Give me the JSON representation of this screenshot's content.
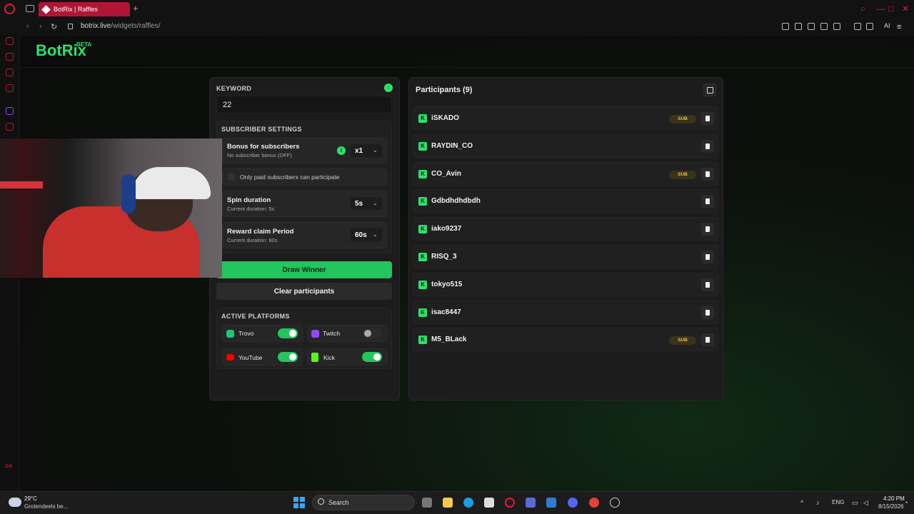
{
  "browser": {
    "tab_title": "BotRix | Raffles",
    "url_host": "botrix.live",
    "url_path": "/widgets/raffles/",
    "ai_label": "AI"
  },
  "app": {
    "logo": "BotRix",
    "beta": "BETA"
  },
  "raffle": {
    "keyword_label": "KEYWORD",
    "keyword_value": "22",
    "info_icon": "i",
    "subscriber_settings_label": "SUBSCRIBER SETTINGS",
    "bonus_title": "Bonus for subscribers",
    "bonus_sub": "No subscriber bonus (OFF)",
    "bonus_value": "x1",
    "paid_only_label": "Only paid subscribers can participate",
    "spin_title": "Spin duration",
    "spin_sub": "Current duration: 5s",
    "spin_value": "5s",
    "reward_title": "Reward claim Period",
    "reward_sub": "Current duration: 60s",
    "reward_value": "60s",
    "draw_label": "Draw Winner",
    "clear_label": "Clear participants",
    "platforms_label": "ACTIVE PLATFORMS",
    "platforms": [
      {
        "name": "Trovo",
        "enabled": true,
        "color": "#1ec47a"
      },
      {
        "name": "Twitch",
        "enabled": false,
        "color": "#9146ff"
      },
      {
        "name": "YouTube",
        "enabled": true,
        "color": "#ff0000"
      },
      {
        "name": "Kick",
        "enabled": true,
        "color": "#53fc18"
      }
    ]
  },
  "participants": {
    "title": "Participants (9)",
    "sub_badge": "SUB",
    "kick_glyph": "K",
    "list": [
      {
        "name": "iSKADO",
        "sub": true
      },
      {
        "name": "RAYDIN_CO",
        "sub": false
      },
      {
        "name": "CO_Avin",
        "sub": true
      },
      {
        "name": "Gdbdhdhdbdh",
        "sub": false
      },
      {
        "name": "iako9237",
        "sub": false
      },
      {
        "name": "RISQ_3",
        "sub": false
      },
      {
        "name": "tokyo515",
        "sub": false
      },
      {
        "name": "isac8447",
        "sub": false
      },
      {
        "name": "M5_BLack",
        "sub": true
      }
    ]
  },
  "taskbar": {
    "weather_temp": "29°C",
    "weather_desc": "Grotendeels be...",
    "search_label": "Search",
    "lang": "ENG",
    "time": "4:20 PM",
    "date": "8/15/2026"
  },
  "sidebar": {
    "gx_label": "GX"
  },
  "colors": {
    "accent": "#2ee06f",
    "browser_accent": "#e11b3c"
  }
}
